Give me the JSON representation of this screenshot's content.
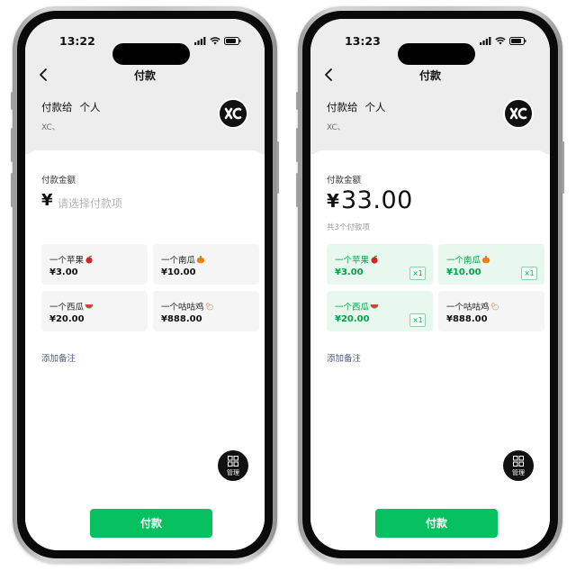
{
  "screens": [
    {
      "time": "13:22",
      "nav_title": "付款",
      "payto_label": "付款给",
      "payto_type": "个人",
      "payee_name": "XC、",
      "amount_label": "付款金额",
      "currency": "¥",
      "placeholder": "请选择付款项",
      "items": [
        {
          "name": "一个苹果",
          "emoji": "apple-icon",
          "price": "¥3.00"
        },
        {
          "name": "一个南瓜",
          "emoji": "pumpkin-icon",
          "price": "¥10.00"
        },
        {
          "name": "一个西瓜",
          "emoji": "watermelon-icon",
          "price": "¥20.00"
        },
        {
          "name": "一个咕咕鸡",
          "emoji": "chicken-icon",
          "price": "¥888.00"
        }
      ],
      "add_note": "添加备注",
      "manage_label": "管理",
      "pay_button": "付款"
    },
    {
      "time": "13:23",
      "nav_title": "付款",
      "payto_label": "付款给",
      "payto_type": "个人",
      "payee_name": "XC、",
      "amount_label": "付款金额",
      "currency": "¥",
      "amount": "33.00",
      "item_count": "共3个付款项",
      "items": [
        {
          "name": "一个苹果",
          "emoji": "apple-icon",
          "price": "¥3.00",
          "selected": true,
          "qty": "×1"
        },
        {
          "name": "一个南瓜",
          "emoji": "pumpkin-icon",
          "price": "¥10.00",
          "selected": true,
          "qty": "×1"
        },
        {
          "name": "一个西瓜",
          "emoji": "watermelon-icon",
          "price": "¥20.00",
          "selected": true,
          "qty": "×1"
        },
        {
          "name": "一个咕咕鸡",
          "emoji": "chicken-icon",
          "price": "¥888.00",
          "selected": false
        }
      ],
      "add_note": "添加备注",
      "manage_label": "管理",
      "pay_button": "付款"
    }
  ],
  "colors": {
    "accent": "#07c160",
    "selected_bg": "#e8f8ee",
    "selected_text": "#07a04a"
  }
}
